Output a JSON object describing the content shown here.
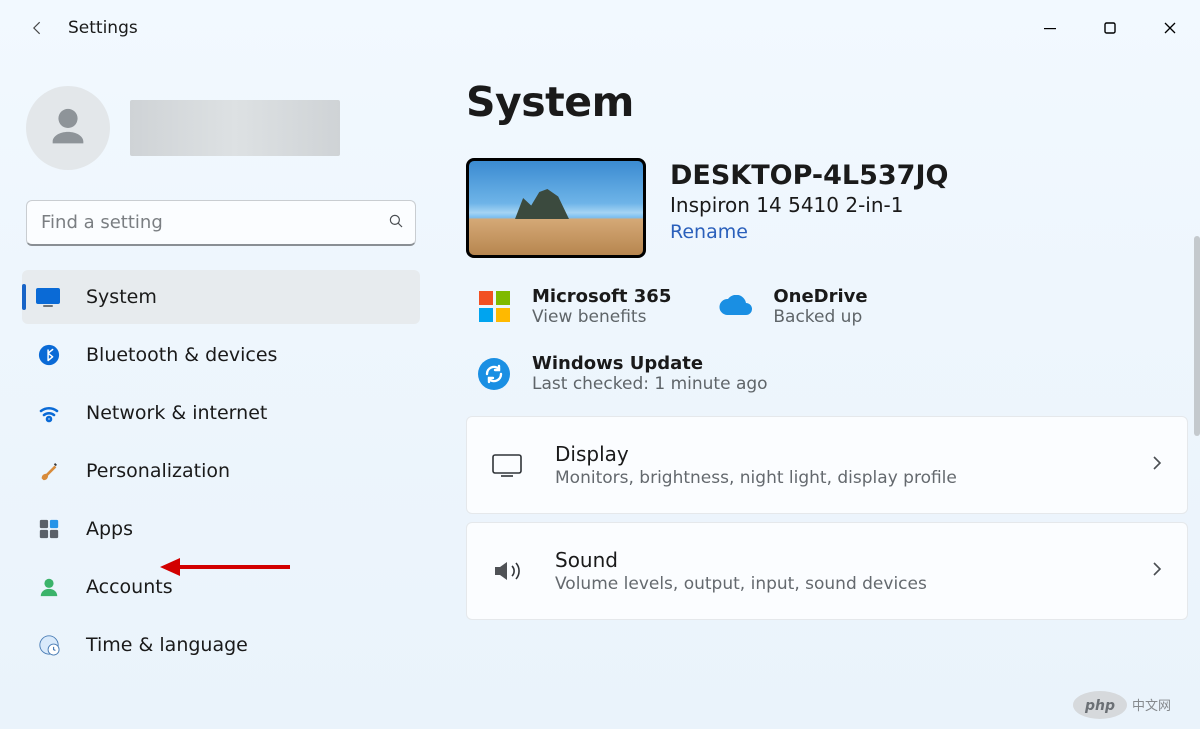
{
  "app_title": "Settings",
  "search": {
    "placeholder": "Find a setting"
  },
  "nav": {
    "items": [
      {
        "label": "System"
      },
      {
        "label": "Bluetooth & devices"
      },
      {
        "label": "Network & internet"
      },
      {
        "label": "Personalization"
      },
      {
        "label": "Apps"
      },
      {
        "label": "Accounts"
      },
      {
        "label": "Time & language"
      }
    ],
    "active_index": 0
  },
  "page": {
    "title": "System"
  },
  "device": {
    "name": "DESKTOP-4L537JQ",
    "model": "Inspiron 14 5410 2-in-1",
    "rename": "Rename"
  },
  "status": {
    "m365": {
      "title": "Microsoft 365",
      "sub": "View benefits"
    },
    "onedrive": {
      "title": "OneDrive",
      "sub": "Backed up"
    },
    "update": {
      "title": "Windows Update",
      "sub": "Last checked: 1 minute ago"
    }
  },
  "settings": {
    "display": {
      "title": "Display",
      "sub": "Monitors, brightness, night light, display profile"
    },
    "sound": {
      "title": "Sound",
      "sub": "Volume levels, output, input, sound devices"
    }
  },
  "watermark": {
    "brand": "php",
    "text": "中文网"
  }
}
